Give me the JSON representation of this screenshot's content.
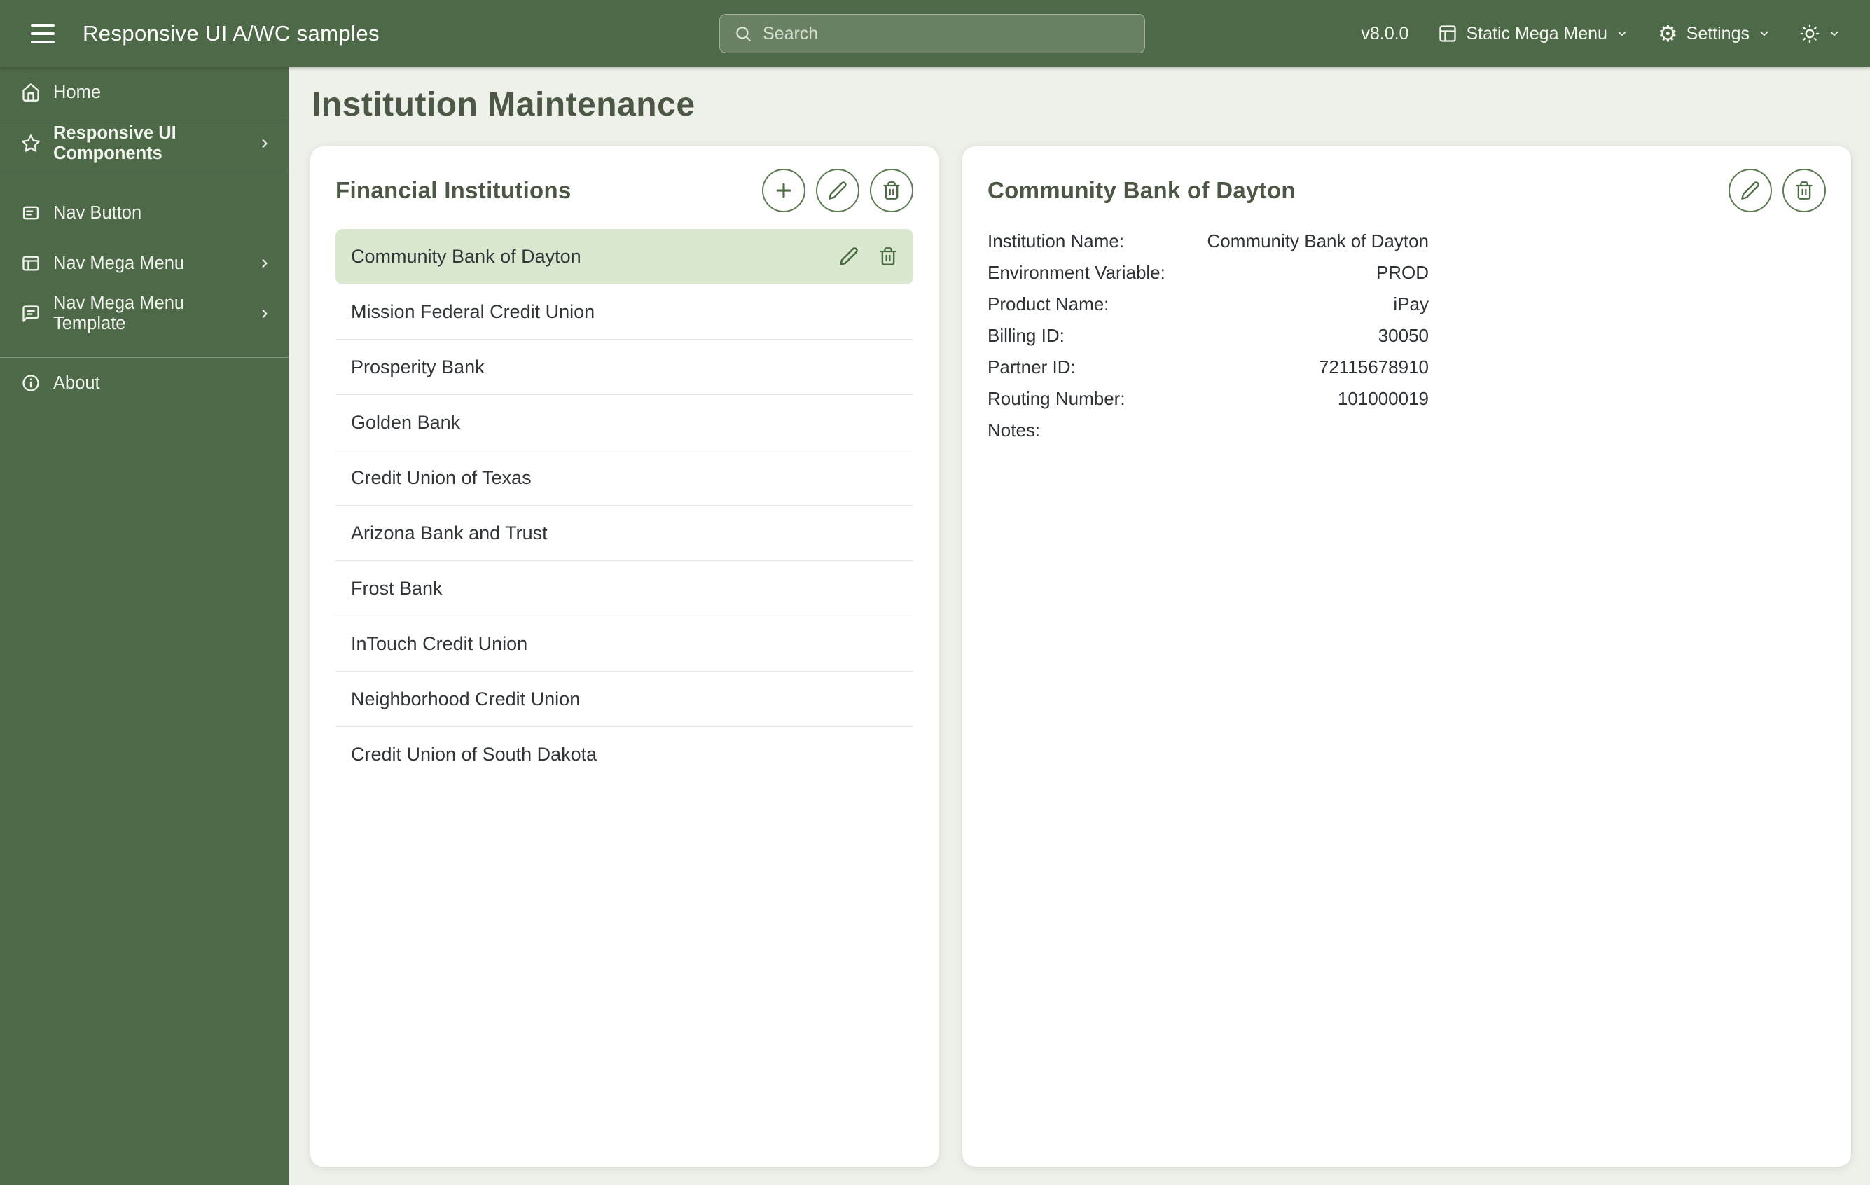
{
  "topbar": {
    "title": "Responsive UI A/WC samples",
    "search": {
      "placeholder": "Search"
    },
    "version": "v8.0.0",
    "mega_menu_label": "Static Mega Menu",
    "settings_label": "Settings"
  },
  "icons": {
    "gear": "⚙"
  },
  "sidebar": {
    "items": [
      {
        "label": "Home",
        "icon": "home-icon"
      },
      {
        "label": "Responsive UI Components",
        "icon": "star-icon"
      },
      {
        "label": "Nav Button",
        "icon": "button-form-icon"
      },
      {
        "label": "Nav Mega Menu",
        "icon": "window-icon"
      },
      {
        "label": "Nav Mega Menu Template",
        "icon": "message-icon"
      },
      {
        "label": "About",
        "icon": "info-icon"
      }
    ]
  },
  "page": {
    "title": "Institution Maintenance"
  },
  "institutions_panel": {
    "title": "Financial Institutions",
    "selected_index": 0,
    "selected_item": "Community Bank of Dayton",
    "items": [
      "Community Bank of Dayton",
      "Mission Federal Credit Union",
      "Prosperity Bank",
      "Golden Bank",
      "Credit Union of Texas",
      "Arizona Bank and Trust",
      "Frost Bank",
      "InTouch Credit Union",
      "Neighborhood Credit Union",
      "Credit Union of South Dakota"
    ]
  },
  "detail_panel": {
    "title": "Community Bank of Dayton",
    "fields": [
      {
        "label": "Institution Name:",
        "value": "Community Bank of Dayton"
      },
      {
        "label": "Environment Variable:",
        "value": "PROD"
      },
      {
        "label": "Product Name:",
        "value": "iPay"
      },
      {
        "label": "Billing ID:",
        "value": "30050"
      },
      {
        "label": "Partner ID:",
        "value": "72115678910"
      },
      {
        "label": "Routing Number:",
        "value": "101000019"
      },
      {
        "label": "Notes:",
        "value": ""
      }
    ]
  },
  "colors": {
    "primary_green": "#4e6947",
    "selected_row_bg": "#d9e8cf",
    "heading_text": "#4c5845",
    "page_background": "#eef0ea"
  }
}
